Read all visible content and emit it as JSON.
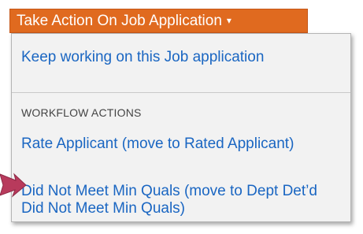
{
  "action_button": {
    "label": "Take Action On Job Application",
    "caret": "▾"
  },
  "menu": {
    "keep_working": "Keep working on this Job application",
    "section_header": "WORKFLOW ACTIONS",
    "rate_applicant": "Rate Applicant (move to Rated Applicant)",
    "did_not_meet": "Did Not Meet Min Quals (move to Dept Det’d Did Not Meet Min Quals)"
  },
  "colors": {
    "button": "#e06a1f",
    "link": "#1a66c2",
    "arrow": "#b83a5c",
    "menu_bg": "#f2f2f2"
  },
  "icons": {
    "pointer": "arrow-right-icon"
  }
}
